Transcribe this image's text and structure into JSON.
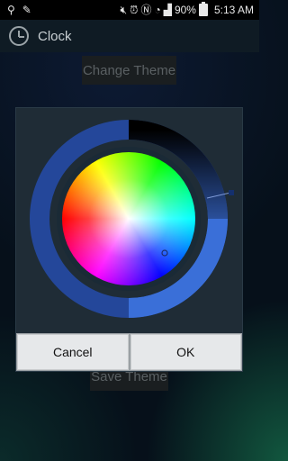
{
  "status_bar": {
    "battery": "90%",
    "time": "5:13 AM"
  },
  "action_bar": {
    "title": "Clock"
  },
  "main": {
    "change_theme_label": "Change Theme",
    "save_theme_label": "Save Theme"
  },
  "dialog": {
    "cancel_label": "Cancel",
    "ok_label": "OK"
  },
  "colors": {
    "accent_ring": "#3a6fd8",
    "dialog_bg": "#1f2c36"
  }
}
